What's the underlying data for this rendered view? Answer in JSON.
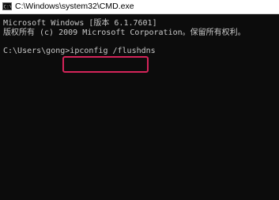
{
  "window": {
    "title": "C:\\Windows\\system32\\CMD.exe",
    "icon": "cmd-icon"
  },
  "console": {
    "lines": [
      "Microsoft Windows [版本 6.1.7601]",
      "版权所有 (c) 2009 Microsoft Corporation。保留所有权利。"
    ],
    "prompt": "C:\\Users\\gong>",
    "command": "ipconfig /flushdns"
  },
  "colors": {
    "console_bg": "#0c0c0c",
    "console_text": "#c8c8c8",
    "highlight_border": "#d4245a"
  }
}
